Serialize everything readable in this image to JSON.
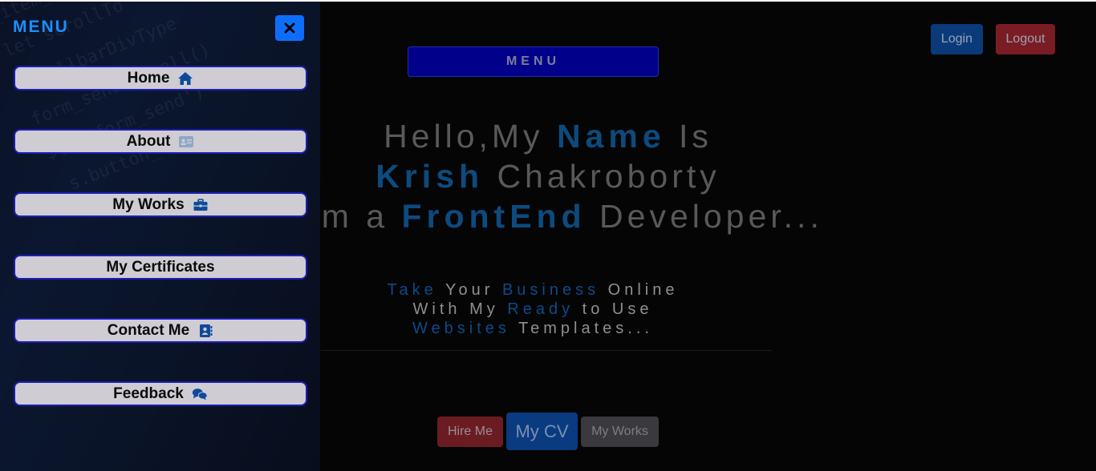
{
  "header": {
    "login_label": "Login",
    "logout_label": "Logout",
    "menu_toggle_label": "MENU"
  },
  "hero": {
    "line1": {
      "a": "Hello,My ",
      "b": "Name",
      "c": " Is"
    },
    "line2": {
      "a": "Krish",
      "b": " Chakroborty"
    },
    "line3": {
      "a": "I am a ",
      "b": "FrontEnd",
      "c": " Developer..."
    }
  },
  "subtitle": {
    "line1": {
      "a": "Take",
      "b": " Your ",
      "c": "Business",
      "d": " Online"
    },
    "line2": {
      "a": "With My ",
      "b": "Ready",
      "c": " to Use"
    },
    "line3": {
      "a": "Websites",
      "b": " Templates..."
    }
  },
  "cta": {
    "hire_label": "Hire Me",
    "cv_label": "My CV",
    "works_label": "My Works"
  },
  "sidebar": {
    "title": "MENU",
    "items": [
      {
        "label": "Home",
        "icon": "home-icon"
      },
      {
        "label": "About",
        "icon": "id-card-icon"
      },
      {
        "label": "My Works",
        "icon": "briefcase-icon"
      },
      {
        "label": "My Certificates",
        "icon": ""
      },
      {
        "label": "Contact Me",
        "icon": "contact-book-icon"
      },
      {
        "label": "Feedback",
        "icon": "comments-icon"
      }
    ]
  },
  "colors": {
    "accent": "#0d6efd",
    "highlight": "#0d4a7e",
    "logout": "#7a1c24"
  }
}
